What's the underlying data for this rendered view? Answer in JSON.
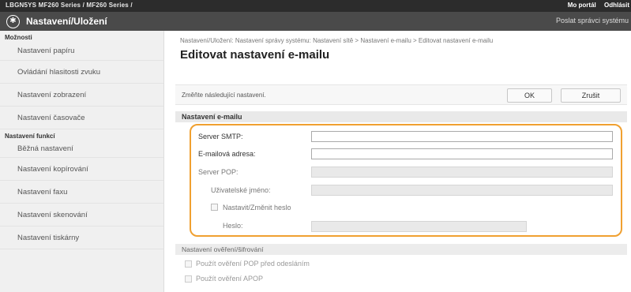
{
  "topbar": {
    "device_name": "LBGN5YS    MF260 Series / MF260 Series /",
    "portal_link": "Mo portál",
    "logout_link": "Odhlásit"
  },
  "titlebar": {
    "app_title": "Nastavení/Uložení",
    "admin_link": "Poslat správci systému"
  },
  "sidebar": {
    "options_header": "Možnosti",
    "options": [
      "Nastavení papíru",
      "Ovládání hlasitosti zvuku",
      "Nastavení zobrazení",
      "Nastavení časovače"
    ],
    "functions_header": "Nastavení funkcí",
    "functions": [
      "Běžná nastavení",
      "Nastavení kopírování",
      "Nastavení faxu",
      "Nastavení skenování",
      "Nastavení tiskárny"
    ]
  },
  "main": {
    "breadcrumb": "Nastavení/Uložení: Nastavení správy systému: Nastavení sítě > Nastavení e-mailu > Editovat nastavení e-mailu",
    "title": "Editovat nastavení e-mailu",
    "hint": "Změňte následující nastavení.",
    "ok_label": "OK",
    "cancel_label": "Zrušit",
    "email_section": {
      "header": "Nastavení e-mailu",
      "smtp_label": "Server SMTP:",
      "smtp_value": "",
      "email_label": "E-mailová adresa:",
      "email_value": "",
      "pop_label": "Server POP:",
      "pop_value": "",
      "username_label": "Uživatelské jméno:",
      "username_value": "",
      "set_password_label": "Nastavit/Změnit heslo",
      "password_label": "Heslo:",
      "password_value": ""
    },
    "auth_section": {
      "header": "Nastavení ověření/šifrování",
      "option1": "Použít ověření POP před odesláním",
      "option2": "Použít ověření APOP"
    }
  },
  "colors": {
    "highlight": "#f0a030",
    "titlebar": "#4a4a4a",
    "topbar": "#2c2c2c"
  }
}
